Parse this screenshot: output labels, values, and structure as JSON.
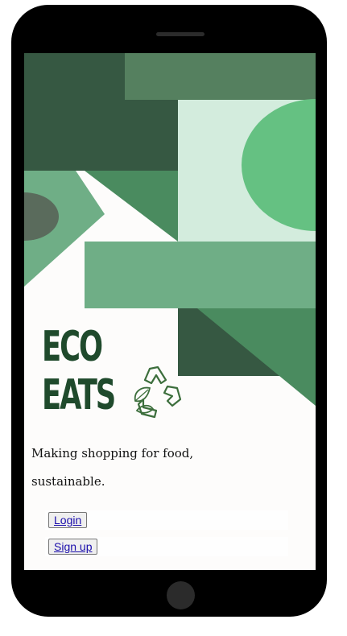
{
  "brand": {
    "line1": "ECO",
    "line2": "EATS",
    "logo_icon": "recycle-leaf-icon",
    "color": "#1f4a2c"
  },
  "tagline": {
    "line1": "Making shopping for food,",
    "line2": "sustainable."
  },
  "actions": {
    "login_label": "Login",
    "signup_label": "Sign up"
  },
  "palette": {
    "dark_green": "#365842",
    "mid_green": "#4a8b5f",
    "light_green": "#6fae86",
    "mint": "#d3ecdd",
    "bright_green": "#65c182",
    "slate": "#5a6b5c"
  }
}
